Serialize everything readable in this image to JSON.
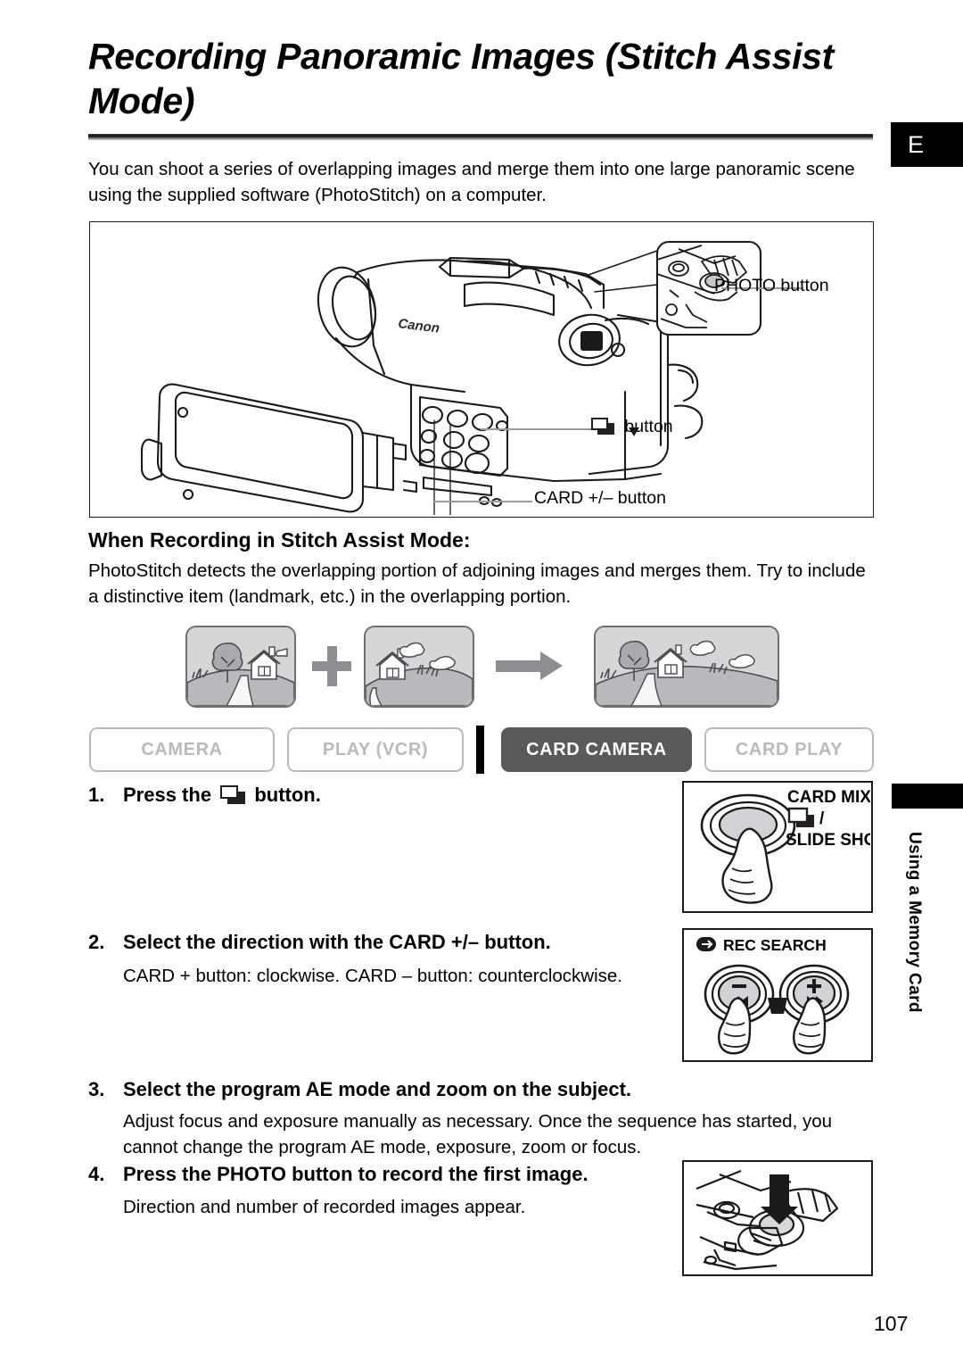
{
  "header": {
    "title": "Recording Panoramic Images (Stitch Assist Mode)",
    "lang_tab": "E",
    "intro": "You can shoot a series of overlapping images and merge them into one large panoramic scene using the supplied software (PhotoStitch) on a computer."
  },
  "figure": {
    "callouts": [
      {
        "label": "PHOTO button"
      },
      {
        "label": "button",
        "icon": "card-mix-icon"
      },
      {
        "label": "CARD +/– button"
      }
    ],
    "brand": "Canon"
  },
  "section": {
    "heading": "When Recording in Stitch Assist Mode:",
    "body": "PhotoStitch detects the overlapping portion of adjoining images and merges them. Try to include a distinctive item (landmark, etc.) in the overlapping portion.",
    "operators": {
      "plus": "+",
      "arrow": "→"
    }
  },
  "mode_bar": {
    "modes": [
      {
        "label": "CAMERA",
        "active": false
      },
      {
        "label": "PLAY (VCR)",
        "active": false
      },
      {
        "label": "CARD CAMERA",
        "active": true
      },
      {
        "label": "CARD PLAY",
        "active": false
      }
    ],
    "active_color": "#5a5a5a",
    "inactive_color": "#b9b9bf"
  },
  "steps": [
    {
      "number": "1.",
      "title_before": "Press the",
      "title_icon": "card-mix-icon",
      "title_after": "button.",
      "body": ""
    },
    {
      "number": "2.",
      "title": "Select the direction with the CARD +/– button.",
      "body": "CARD + button: clockwise. CARD – button: counterclockwise."
    },
    {
      "number": "3.",
      "title": "Select the program AE mode and zoom on the subject.",
      "body": "Adjust focus and exposure manually as necessary. Once the sequence has started, you cannot change the program AE mode, exposure, zoom or focus."
    },
    {
      "number": "4.",
      "title": "Press the PHOTO button to record the first image.",
      "body": "Direction and number of recorded images appear."
    }
  ],
  "illustrations": {
    "card_mix_button": {
      "line1": "CARD MIX/",
      "line2": "/",
      "line3": "SLIDE SHOW",
      "icon": "card-mix-icon"
    },
    "rec_search": {
      "label": "REC SEARCH",
      "minus": "–",
      "plus": "+",
      "rewind": "◀◀",
      "forward": "▶▶",
      "icon": "rec-search-icon"
    }
  },
  "side_tab": {
    "label": "Using a Memory Card"
  },
  "page_number": "107"
}
